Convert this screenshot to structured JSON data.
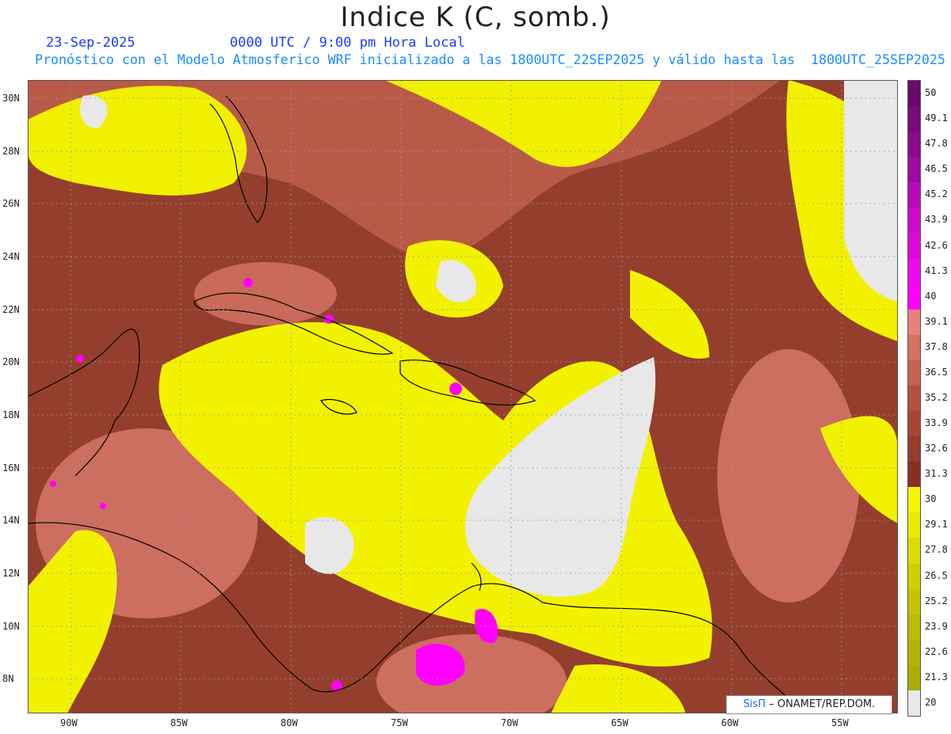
{
  "header": {
    "title": "Indice K (C, somb.)",
    "date": "23-Sep-2025",
    "utc_time": "0000 UTC / 9:00 pm Hora Local",
    "model_line": "Pronóstico con el Modelo Atmosferico WRF inicializado a las 1800UTC_22SEP2025 y válido hasta las  1800UTC_25SEP2025"
  },
  "map": {
    "lat_ticks": [
      "30N",
      "28N",
      "26N",
      "24N",
      "22N",
      "20N",
      "18N",
      "16N",
      "14N",
      "12N",
      "10N",
      "8N"
    ],
    "lon_ticks": [
      "90W",
      "85W",
      "80W",
      "75W",
      "70W",
      "65W",
      "60W",
      "55W"
    ],
    "colors": {
      "land_outline": "#000000",
      "grid": "#bbbbbb",
      "high_brown": "#8b3a2a",
      "mid_rose": "#c96a5a",
      "yellow": "#f2f200",
      "low_gray": "#e6e6e6",
      "magenta": "#ff00ff"
    }
  },
  "colorbar": {
    "labels": [
      "50",
      "49.1",
      "47.8",
      "46.5",
      "45.2",
      "43.9",
      "42.6",
      "41.3",
      "40",
      "39.1",
      "37.8",
      "36.5",
      "35.2",
      "33.9",
      "32.6",
      "31.3",
      "30",
      "29.1",
      "27.8",
      "26.5",
      "25.2",
      "23.9",
      "22.6",
      "21.3",
      "20"
    ],
    "colors": [
      "#6a0a6a",
      "#7a0a7a",
      "#8a0a8a",
      "#a00aa0",
      "#b80ab8",
      "#cc0acc",
      "#dd0add",
      "#ee0aee",
      "#ff00ff",
      "#e88080",
      "#d97060",
      "#c8604e",
      "#b85040",
      "#a84535",
      "#983a2c",
      "#88301f",
      "#f6f600",
      "#eaea00",
      "#dcdc00",
      "#d0d000",
      "#c4c400",
      "#bcbc00",
      "#b4b400",
      "#acac00",
      "#e8e8e8"
    ]
  },
  "credit": {
    "logo": "SisΠ",
    "text": "– ONAMET/REP.DOM."
  }
}
